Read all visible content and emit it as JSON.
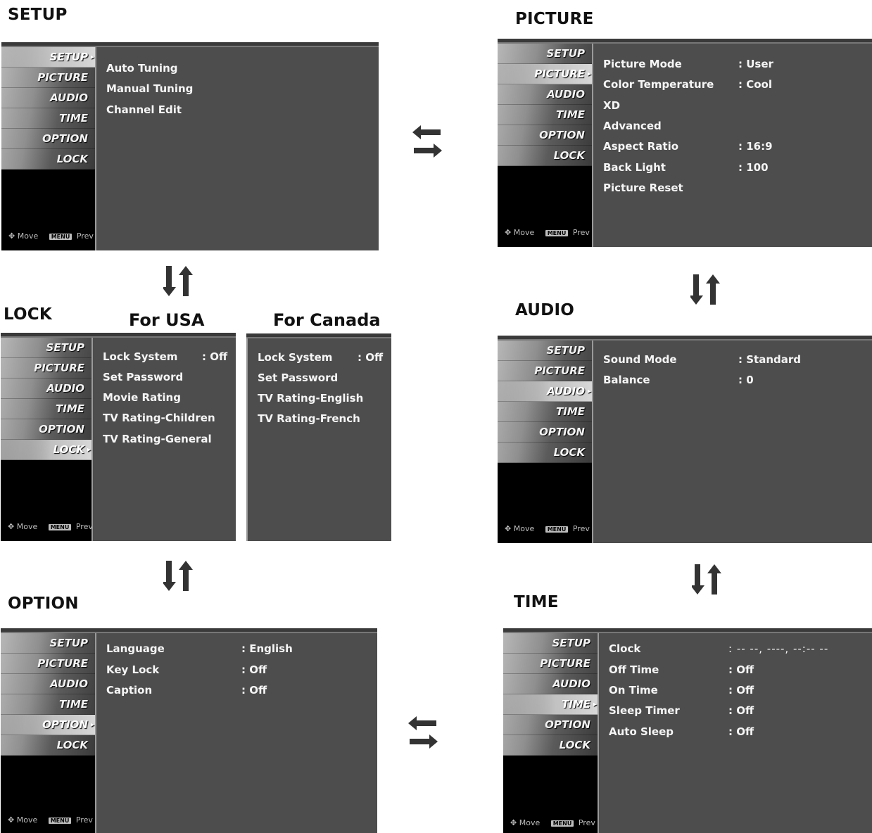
{
  "headings": {
    "setup": "SETUP",
    "picture": "PICTURE",
    "lock": "LOCK",
    "audio": "AUDIO",
    "option": "OPTION",
    "time": "TIME",
    "for_usa": "For USA",
    "for_canada": "For Canada"
  },
  "side_menu": [
    "SETUP",
    "PICTURE",
    "AUDIO",
    "TIME",
    "OPTION",
    "LOCK"
  ],
  "footer": {
    "move": "Move",
    "menu_key": "MENU",
    "prev": "Prev"
  },
  "setup_menu": {
    "items": [
      "Auto Tuning",
      "Manual Tuning",
      "Channel Edit"
    ]
  },
  "picture_menu": {
    "items": [
      {
        "label": "Picture Mode",
        "value": ": User"
      },
      {
        "label": "Color Temperature",
        "value": ": Cool"
      },
      {
        "label": "XD",
        "value": ""
      },
      {
        "label": "Advanced",
        "value": ""
      },
      {
        "label": "Aspect Ratio",
        "value": ": 16:9"
      },
      {
        "label": "Back Light",
        "value": ": 100"
      },
      {
        "label": "Picture Reset",
        "value": ""
      }
    ]
  },
  "lock_usa_menu": {
    "items": [
      {
        "label": "Lock System",
        "value": ": Off"
      },
      {
        "label": "Set Password",
        "value": ""
      },
      {
        "label": "Movie Rating",
        "value": ""
      },
      {
        "label": "TV Rating-Children",
        "value": ""
      },
      {
        "label": "TV Rating-General",
        "value": ""
      }
    ]
  },
  "lock_canada_menu": {
    "items": [
      {
        "label": "Lock System",
        "value": ": Off"
      },
      {
        "label": "Set Password",
        "value": ""
      },
      {
        "label": "TV Rating-English",
        "value": ""
      },
      {
        "label": "TV Rating-French",
        "value": ""
      }
    ]
  },
  "audio_menu": {
    "items": [
      {
        "label": "Sound Mode",
        "value": ": Standard"
      },
      {
        "label": "Balance",
        "value": ": 0"
      }
    ]
  },
  "option_menu": {
    "items": [
      {
        "label": "Language",
        "value": ": English"
      },
      {
        "label": "Key Lock",
        "value": ": Off"
      },
      {
        "label": "Caption",
        "value": ": Off"
      }
    ]
  },
  "time_menu": {
    "items": [
      {
        "label": "Clock",
        "value": ": -- --, ----, --:-- --"
      },
      {
        "label": "Off Time",
        "value": ": Off"
      },
      {
        "label": "On Time",
        "value": ": Off"
      },
      {
        "label": "Sleep Timer",
        "value": ": Off"
      },
      {
        "label": "Auto Sleep",
        "value": ": Off"
      }
    ]
  },
  "colors": {
    "panel_bg": "#4d4d4d",
    "sidebar_bg": "#000000",
    "text": "#f5f5f5",
    "arrow": "#333333"
  },
  "icons": {
    "horizontal_nav": "left-right-arrows-icon",
    "vertical_nav": "up-down-arrows-icon",
    "move": "move-cross-icon"
  }
}
